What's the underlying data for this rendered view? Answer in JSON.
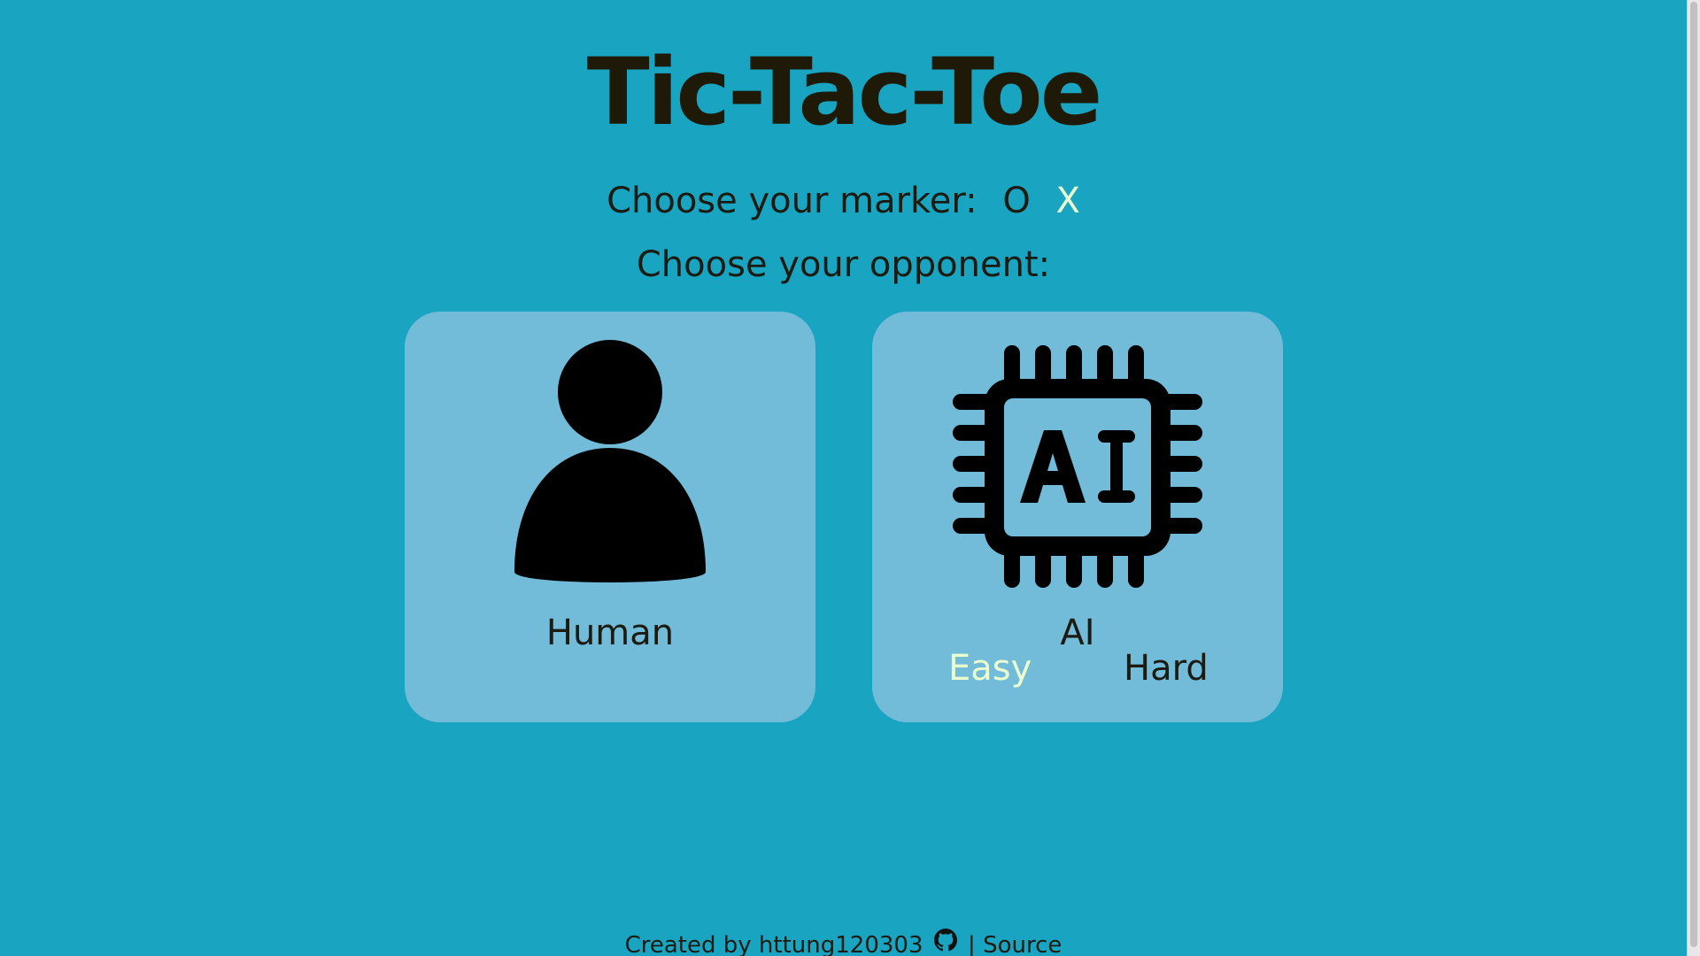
{
  "title": "Tic-Tac-Toe",
  "marker": {
    "label": "Choose your marker:",
    "options": [
      "O",
      "X"
    ],
    "selected": "X"
  },
  "opponent": {
    "label": "Choose your opponent:",
    "human": {
      "label": "Human",
      "icon": "person-icon"
    },
    "ai": {
      "label": "AI",
      "icon": "ai-chip-icon",
      "difficulty": {
        "easy": "Easy",
        "hard": "Hard",
        "selected": "Easy"
      }
    }
  },
  "footer": {
    "created_by": "Created by",
    "author": "httung120303",
    "icon": "github-icon",
    "separator": "|",
    "source": "Source"
  },
  "colors": {
    "background": "#19a4c1",
    "card": "#72bbd9",
    "selected": "#e9ffcf",
    "text": "#1b1b12"
  }
}
